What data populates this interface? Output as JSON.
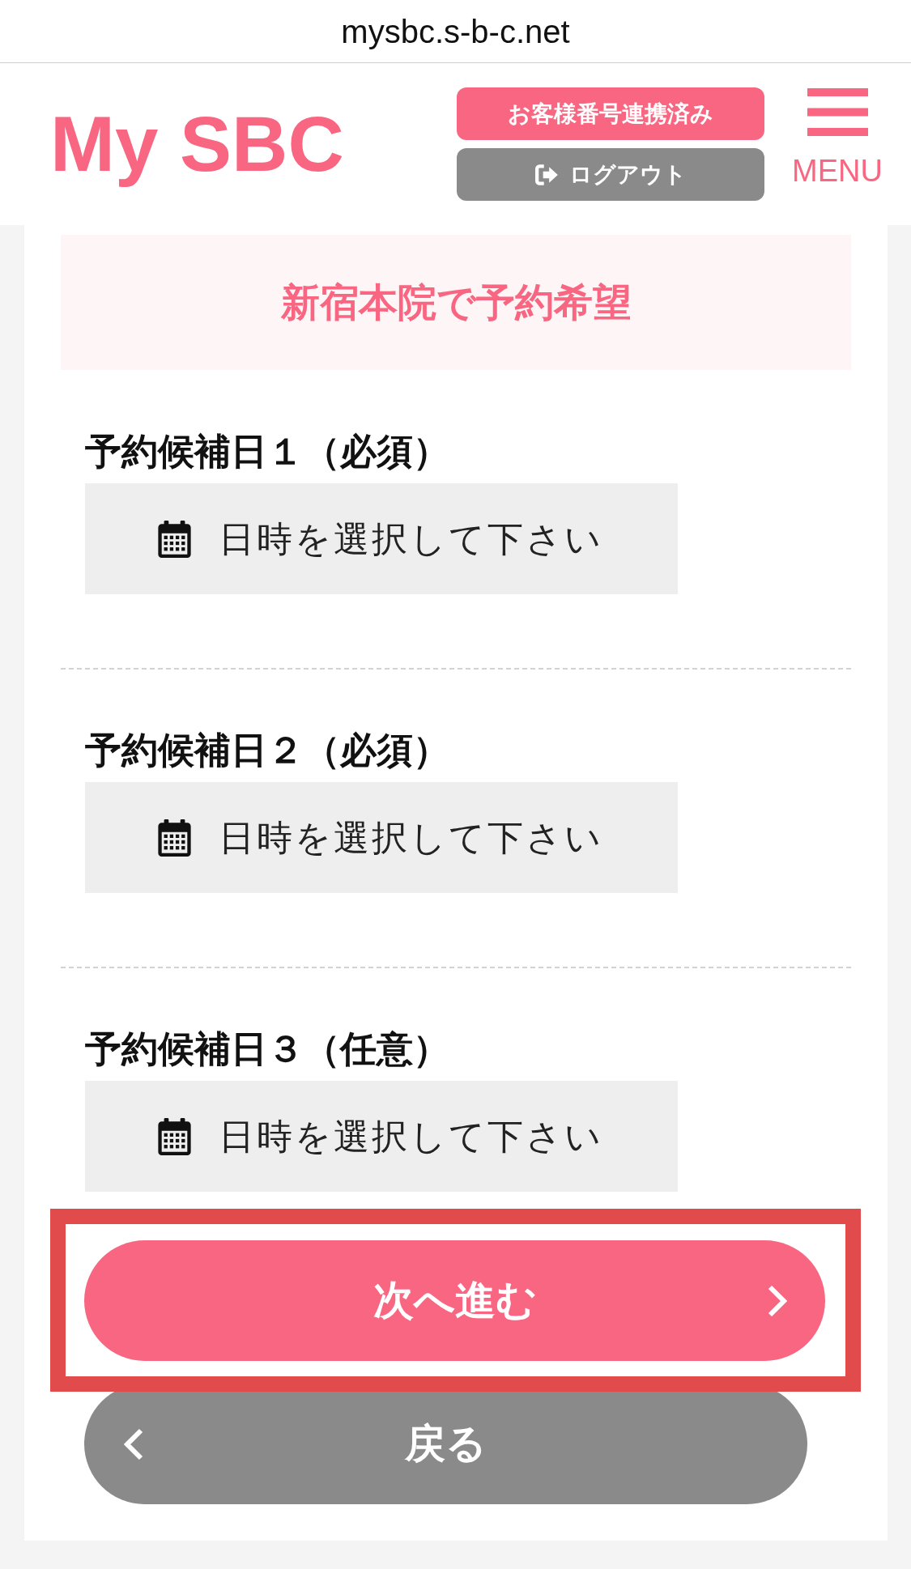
{
  "browser": {
    "url": "mysbc.s-b-c.net"
  },
  "header": {
    "logo": "My SBC",
    "account_status": "お客様番号連携済み",
    "logout_button": "ログアウト",
    "menu_label": "MENU"
  },
  "clinic_banner": {
    "title": "新宿本院で予約希望"
  },
  "date_fields": [
    {
      "label": "予約候補日１（必須）",
      "placeholder": "日時を選択して下さい"
    },
    {
      "label": "予約候補日２（必須）",
      "placeholder": "日時を選択して下さい"
    },
    {
      "label": "予約候補日３（任意）",
      "placeholder": "日時を選択して下さい"
    }
  ],
  "buttons": [
    {
      "kind": "next",
      "label": "次へ進む",
      "highlighted": true
    },
    {
      "kind": "back",
      "label": "戻る",
      "highlighted": false
    }
  ]
}
